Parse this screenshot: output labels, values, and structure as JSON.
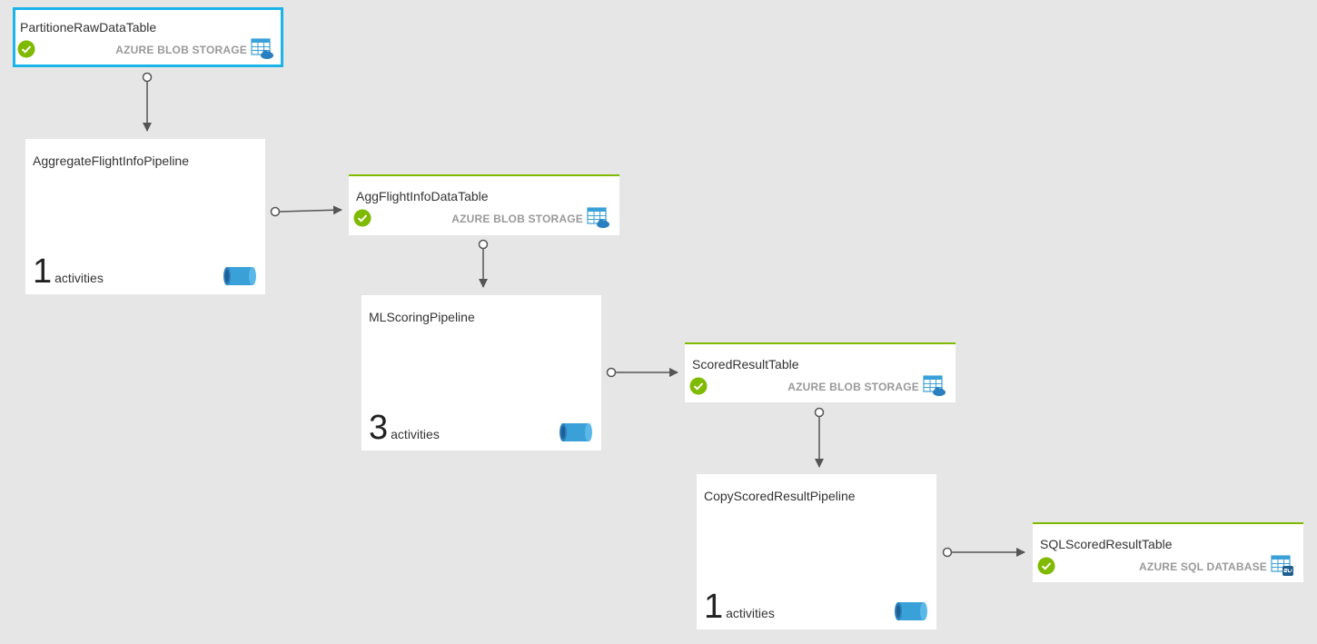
{
  "datasets": [
    {
      "id": "partition-raw",
      "name": "PartitioneRawDataTable",
      "type_label": "AZURE BLOB STORAGE",
      "type_icon": "blob-table-icon",
      "status": "success",
      "selected": true
    },
    {
      "id": "agg-flight",
      "name": "AggFlightInfoDataTable",
      "type_label": "AZURE BLOB STORAGE",
      "type_icon": "blob-table-icon",
      "status": "success",
      "selected": false
    },
    {
      "id": "scored-result",
      "name": "ScoredResultTable",
      "type_label": "AZURE BLOB STORAGE",
      "type_icon": "blob-table-icon",
      "status": "success",
      "selected": false
    },
    {
      "id": "sql-scored",
      "name": "SQLScoredResultTable",
      "type_label": "AZURE SQL DATABASE",
      "type_icon": "sql-table-icon",
      "status": "success",
      "selected": false
    }
  ],
  "pipelines": [
    {
      "id": "aggregate-pipeline",
      "name": "AggregateFlightInfoPipeline",
      "activity_count": "1",
      "activity_label": "activities"
    },
    {
      "id": "mlscoring-pipeline",
      "name": "MLScoringPipeline",
      "activity_count": "3",
      "activity_label": "activities"
    },
    {
      "id": "copy-pipeline",
      "name": "CopyScoredResultPipeline",
      "activity_count": "1",
      "activity_label": "activities"
    }
  ],
  "colors": {
    "canvas_bg": "#e6e6e6",
    "selected_border": "#1ab4e8",
    "dataset_accent": "#7fba00",
    "status_success": "#7fba00",
    "connector": "#555555",
    "pipe_icon": "#3aa0d8"
  }
}
